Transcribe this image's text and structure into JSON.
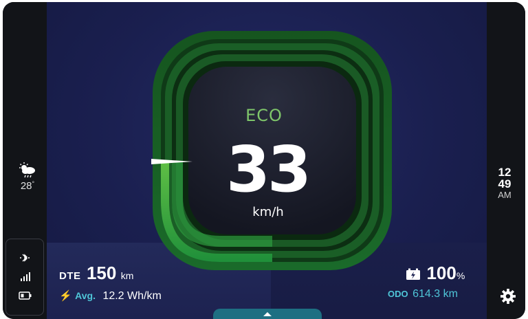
{
  "mode": {
    "label": "ECO"
  },
  "speed": {
    "value": "33",
    "unit": "km/h",
    "fraction_of_max": 0.33
  },
  "weather": {
    "temperature": "28",
    "degree_symbol": "°",
    "icon": "partly-cloudy-rain-icon"
  },
  "clock": {
    "hour": "12",
    "minute": "49",
    "ampm": "AM"
  },
  "status": {
    "bluetooth_icon": "bluetooth-icon",
    "signal_icon": "signal-icon",
    "battery_icon": "battery-low-icon"
  },
  "range": {
    "label": "DTE",
    "value": "150",
    "unit": "km"
  },
  "efficiency": {
    "label": "Avg.",
    "value": "12.2 Wh/km"
  },
  "battery": {
    "value": "100",
    "unit": "%"
  },
  "odometer": {
    "label": "ODO",
    "value": "614.3 km"
  },
  "colors": {
    "accent_green": "#7fc66a",
    "accent_cyan": "#4fc6d8",
    "background": "#1a1f4f"
  }
}
